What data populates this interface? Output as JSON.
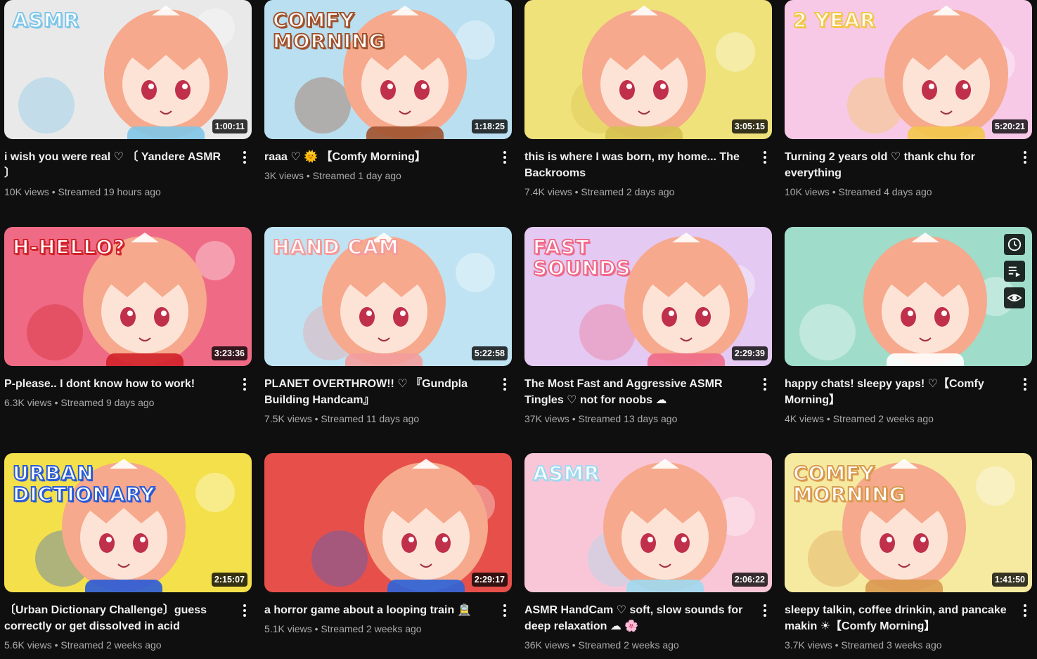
{
  "videos": [
    {
      "title": "i wish you were real ♡ 〔 Yandere ASMR 〕",
      "views": "10K views",
      "streamed": "Streamed 19 hours ago",
      "duration": "1:00:11",
      "thumb_text": "ASMR",
      "thumb_colors": {
        "bg": "#e9e9ea",
        "hair": "#f6a98c",
        "accent": "#7fc6e8"
      }
    },
    {
      "title": "raaa ♡ 🌞 【Comfy Morning】",
      "views": "3K views",
      "streamed": "Streamed 1 day ago",
      "duration": "1:18:25",
      "thumb_text": "COMFY MORNING",
      "thumb_colors": {
        "bg": "#b9dff1",
        "hair": "#f6a98c",
        "accent": "#a0522d"
      }
    },
    {
      "title": "this is where I was born, my home... The Backrooms",
      "views": "7.4K views",
      "streamed": "Streamed 2 days ago",
      "duration": "3:05:15",
      "thumb_text": "",
      "thumb_colors": {
        "bg": "#f0e27a",
        "hair": "#f6a98c",
        "accent": "#d6c24f"
      }
    },
    {
      "title": "Turning 2 years old ♡ thank chu for everything",
      "views": "10K views",
      "streamed": "Streamed 4 days ago",
      "duration": "5:20:21",
      "thumb_text": "2 YEAR",
      "thumb_colors": {
        "bg": "#f7c9e6",
        "hair": "#f6a98c",
        "accent": "#f3c64a"
      }
    },
    {
      "title": "P-please.. I dont know how to work!",
      "views": "6.3K views",
      "streamed": "Streamed 9 days ago",
      "duration": "3:23:36",
      "thumb_text": "H-HELLO?",
      "thumb_colors": {
        "bg": "#ef6b85",
        "hair": "#f6a98c",
        "accent": "#d0222a"
      }
    },
    {
      "title": "PLANET OVERTHROW!! ♡ 『Gundpla Building Handcam』",
      "views": "7.5K views",
      "streamed": "Streamed 11 days ago",
      "duration": "5:22:58",
      "thumb_text": "HAND CAM",
      "thumb_colors": {
        "bg": "#bfe3f3",
        "hair": "#f6a98c",
        "accent": "#f49c9c"
      }
    },
    {
      "title": "The Most Fast and Aggressive ASMR Tingles ♡ not for noobs ☁",
      "views": "37K views",
      "streamed": "Streamed 13 days ago",
      "duration": "2:29:39",
      "thumb_text": "FAST SOUNDS",
      "thumb_colors": {
        "bg": "#e4c9f2",
        "hair": "#f6a98c",
        "accent": "#f06a8a"
      }
    },
    {
      "title": "happy chats! sleepy yaps! ♡【Comfy Morning】",
      "views": "4K views",
      "streamed": "Streamed 2 weeks ago",
      "duration": "",
      "thumb_text": "",
      "thumb_colors": {
        "bg": "#9fdcc9",
        "hair": "#f6a98c",
        "accent": "#ffffff"
      },
      "hover_actions": [
        "clock-icon",
        "add-to-queue-icon",
        "eye-icon"
      ]
    },
    {
      "title": "〔Urban Dictionary Challenge〕guess correctly or get dissolved in acid",
      "views": "5.6K views",
      "streamed": "Streamed 2 weeks ago",
      "duration": "2:15:07",
      "thumb_text": "URBAN DICTIONARY",
      "thumb_colors": {
        "bg": "#f4e04a",
        "hair": "#f6a98c",
        "accent": "#2a5bd7"
      }
    },
    {
      "title": "a horror game about a looping train 🚊",
      "views": "5.1K views",
      "streamed": "Streamed 2 weeks ago",
      "duration": "2:29:17",
      "thumb_text": "",
      "thumb_colors": {
        "bg": "#e7504a",
        "hair": "#f6a98c",
        "accent": "#2b63d9"
      }
    },
    {
      "title": "ASMR HandCam ♡ soft, slow sounds for deep relaxation ☁ 🌸",
      "views": "36K views",
      "streamed": "Streamed 2 weeks ago",
      "duration": "2:06:22",
      "thumb_text": "ASMR",
      "thumb_colors": {
        "bg": "#f9c6d8",
        "hair": "#f6a98c",
        "accent": "#9fd9f0"
      }
    },
    {
      "title": "sleepy talkin, coffee drinkin, and pancake makin ☀【Comfy Morning】",
      "views": "3.7K views",
      "streamed": "Streamed 3 weeks ago",
      "duration": "1:41:50",
      "thumb_text": "COMFY MORNING",
      "thumb_colors": {
        "bg": "#f6eaa0",
        "hair": "#f6a98c",
        "accent": "#d99a4f"
      }
    }
  ]
}
